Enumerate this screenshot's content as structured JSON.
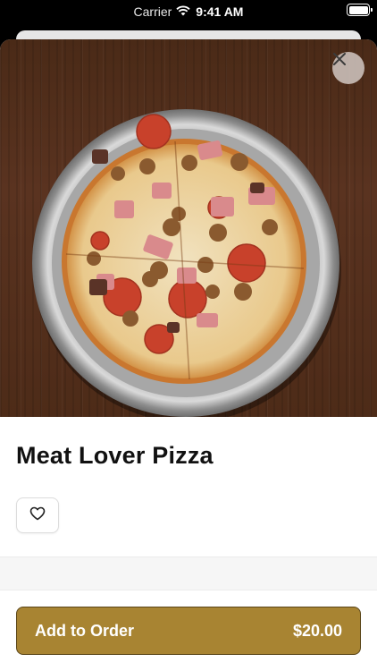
{
  "status_bar": {
    "carrier": "Carrier",
    "time": "9:41 AM"
  },
  "product": {
    "name": "Meat Lover Pizza",
    "image": "meat lover pizza photo"
  },
  "actions": {
    "add_label": "Add to Order",
    "price": "$20.00"
  },
  "icons": {
    "close": "close-icon",
    "favorite": "heart-outline-icon",
    "wifi": "wifi-icon",
    "battery": "battery-icon"
  },
  "colors": {
    "accent": "#a88432",
    "accent_border": "#5a4518"
  }
}
